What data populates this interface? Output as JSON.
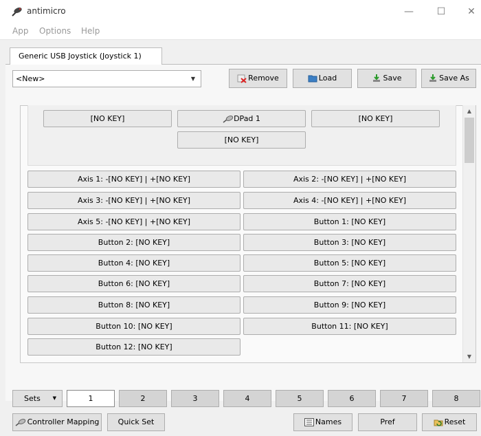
{
  "window": {
    "title": "antimicro"
  },
  "menu": {
    "app": "App",
    "options": "Options",
    "help": "Help"
  },
  "tab": {
    "label": "Generic  USB  Joystick  (Joystick 1)"
  },
  "profile": {
    "selected": "<New>"
  },
  "toolbar": {
    "remove": "Remove",
    "load": "Load",
    "save": "Save",
    "save_as": "Save As"
  },
  "dpad": {
    "left": "[NO KEY]",
    "center": "DPad 1",
    "right": "[NO KEY]",
    "bottom": "[NO KEY]"
  },
  "mappings": [
    "Axis 1: -[NO KEY] | +[NO KEY]",
    "Axis 2: -[NO KEY] | +[NO KEY]",
    "Axis 3: -[NO KEY] | +[NO KEY]",
    "Axis 4: -[NO KEY] | +[NO KEY]",
    "Axis 5: -[NO KEY] | +[NO KEY]",
    "Button 1: [NO KEY]",
    "Button 2: [NO KEY]",
    "Button 3: [NO KEY]",
    "Button 4: [NO KEY]",
    "Button 5: [NO KEY]",
    "Button 6: [NO KEY]",
    "Button 7: [NO KEY]",
    "Button 8: [NO KEY]",
    "Button 9: [NO KEY]",
    "Button 10: [NO KEY]",
    "Button 11: [NO KEY]",
    "Button 12: [NO KEY]"
  ],
  "sets": {
    "label": "Sets",
    "items": [
      "1",
      "2",
      "3",
      "4",
      "5",
      "6",
      "7",
      "8"
    ],
    "active": "1"
  },
  "bottom": {
    "controller_mapping": "Controller Mapping",
    "quick_set": "Quick Set",
    "names": "Names",
    "pref": "Pref",
    "reset": "Reset"
  }
}
